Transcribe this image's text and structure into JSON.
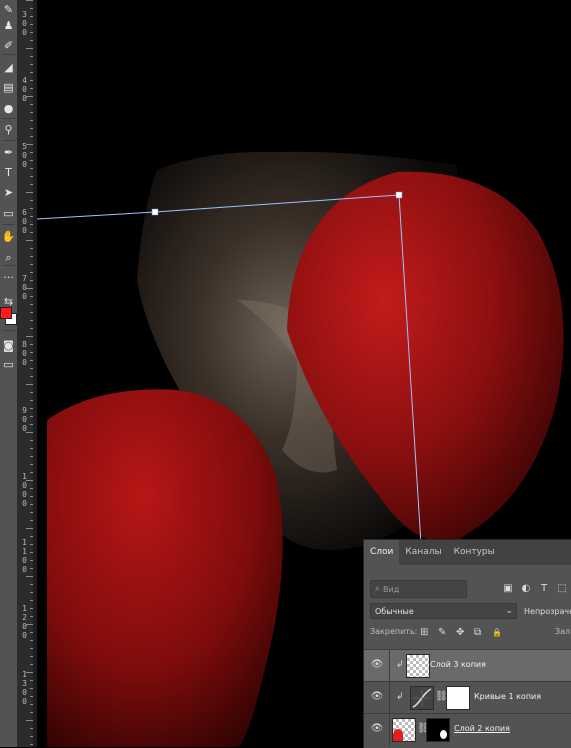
{
  "tools": [
    {
      "icon": "brush-icon",
      "glyph": "✎"
    },
    {
      "icon": "clone-stamp-icon",
      "glyph": "♟"
    },
    {
      "icon": "history-brush-icon",
      "glyph": "✐"
    },
    {
      "icon": "eraser-icon",
      "glyph": "◢"
    },
    {
      "icon": "gradient-icon",
      "glyph": "▤"
    },
    {
      "icon": "blur-icon",
      "glyph": "●"
    },
    {
      "icon": "dodge-icon",
      "glyph": "⚲"
    },
    {
      "icon": "pen-icon",
      "glyph": "✒"
    },
    {
      "icon": "type-icon",
      "glyph": "T"
    },
    {
      "icon": "path-selection-icon",
      "glyph": "➤"
    },
    {
      "icon": "rectangle-icon",
      "glyph": "▭"
    },
    {
      "icon": "hand-icon",
      "glyph": "✋"
    },
    {
      "icon": "zoom-icon",
      "glyph": "⌕"
    },
    {
      "icon": "more-tools-icon",
      "glyph": "···"
    },
    {
      "icon": "swap-colors-icon",
      "glyph": "⇆"
    },
    {
      "icon": "quick-mask-icon",
      "glyph": "◙"
    },
    {
      "icon": "screen-mode-icon",
      "glyph": "▭"
    }
  ],
  "colors": {
    "foreground": "#ff1a1a",
    "background": "#ffffff",
    "path": "#9fc2ff"
  },
  "ruler": {
    "labels": [
      "3",
      "0",
      "0",
      "4",
      "0",
      "0",
      "5",
      "0",
      "0",
      "6",
      "0",
      "0",
      "7",
      "0",
      "0",
      "8",
      "0",
      "0",
      "9",
      "0",
      "0",
      "1",
      "0",
      "0",
      "0",
      "1",
      "1",
      "0",
      "0",
      "1",
      "2",
      "0",
      "0",
      "1",
      "3",
      "0",
      "0"
    ]
  },
  "layers_panel": {
    "tabs": [
      "Слои",
      "Каналы",
      "Контуры"
    ],
    "search_placeholder": "Вид",
    "filter_icons": [
      {
        "icon": "image-filter-icon",
        "glyph": "▣"
      },
      {
        "icon": "adjustment-filter-icon",
        "glyph": "◐"
      },
      {
        "icon": "type-filter-icon",
        "glyph": "T"
      },
      {
        "icon": "shape-filter-icon",
        "glyph": "⬚"
      }
    ],
    "blend_mode": "Обычные",
    "opacity_label": "Непрозрачн",
    "lock_label": "Закрепить:",
    "lock_icons": [
      {
        "icon": "lock-transparency-icon",
        "glyph": "⊞"
      },
      {
        "icon": "lock-image-icon",
        "glyph": "✎"
      },
      {
        "icon": "lock-position-icon",
        "glyph": "✥"
      },
      {
        "icon": "artboard-lock-icon",
        "glyph": "⧉"
      },
      {
        "icon": "lock-all-icon",
        "glyph": "🔒"
      }
    ],
    "fill_label": "Зал",
    "layers": [
      {
        "name": "Слой 3 копия",
        "selected": true,
        "thumb": "checker",
        "mask": false
      },
      {
        "name": "Кривые 1 копия",
        "selected": false,
        "thumb": "curves",
        "mask": true
      },
      {
        "name": "Слой 2 копия",
        "selected": false,
        "thumb": "red",
        "mask": true
      }
    ]
  }
}
